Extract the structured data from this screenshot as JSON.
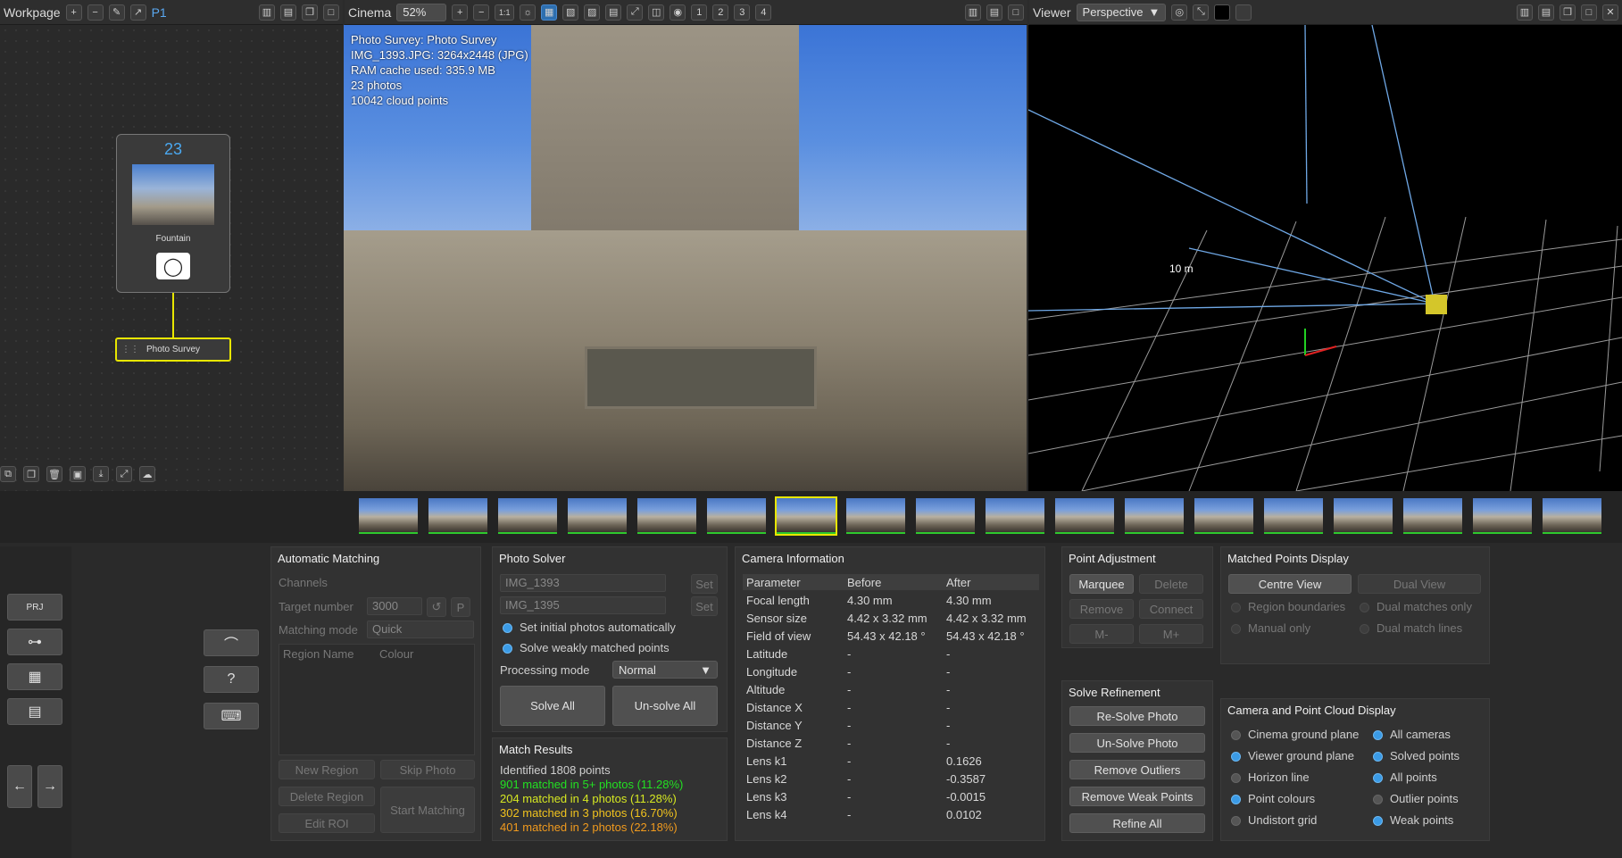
{
  "workpage": {
    "title": "Workpage",
    "page": "P1"
  },
  "cinema": {
    "title": "Cinema",
    "zoom": "52%",
    "ratio": "1:1",
    "nums": [
      "1",
      "2",
      "3",
      "4"
    ],
    "overlay": [
      "Photo Survey: Photo Survey",
      "IMG_1393.JPG: 3264x2448 (JPG)",
      "RAM cache used: 335.9 MB",
      "23 photos",
      "10042 cloud points"
    ]
  },
  "viewer": {
    "title": "Viewer",
    "mode": "Perspective",
    "scale_label": "10 m"
  },
  "nodes": {
    "count": "23",
    "source_label": "Fountain",
    "survey_label": "Photo Survey"
  },
  "auto": {
    "title": "Automatic Matching",
    "channels": "Channels",
    "target_label": "Target number",
    "target_value": "3000",
    "p": "P",
    "mode_label": "Matching mode",
    "mode_value": "Quick",
    "col_region": "Region Name",
    "col_colour": "Colour",
    "new_region": "New Region",
    "skip_photo": "Skip Photo",
    "delete_region": "Delete Region",
    "start_matching": "Start Matching",
    "edit_roi": "Edit ROI"
  },
  "solver": {
    "title": "Photo Solver",
    "img1": "IMG_1393",
    "img2": "IMG_1395",
    "set": "Set",
    "opt1": "Set initial photos automatically",
    "opt2": "Solve weakly matched points",
    "proc_label": "Processing mode",
    "proc_value": "Normal",
    "solve_all": "Solve All",
    "unsolve_all": "Un-solve All"
  },
  "match": {
    "title": "Match Results",
    "identified": "Identified 1808 points",
    "r1": "901 matched in 5+ photos (11.28%)",
    "r2": "204 matched in 4 photos (11.28%)",
    "r3": "302 matched in 3 photos (16.70%)",
    "r4": "401 matched in 2 photos (22.18%)",
    "colors": [
      "#22e022",
      "#d6e822",
      "#f0c21e",
      "#f09a1e"
    ]
  },
  "camera": {
    "title": "Camera Information",
    "headers": [
      "Parameter",
      "Before",
      "After"
    ],
    "rows": [
      [
        "Focal length",
        "4.30 mm",
        "4.30 mm"
      ],
      [
        "Sensor size",
        "4.42 x 3.32 mm",
        "4.42 x 3.32 mm"
      ],
      [
        "Field of view",
        "54.43 x 42.18 °",
        "54.43 x 42.18 °"
      ],
      [
        "Latitude",
        "-",
        "-"
      ],
      [
        "Longitude",
        "-",
        "-"
      ],
      [
        "Altitude",
        "-",
        "-"
      ],
      [
        "Distance X",
        "-",
        "-"
      ],
      [
        "Distance Y",
        "-",
        "-"
      ],
      [
        "Distance Z",
        "-",
        "-"
      ],
      [
        "Lens k1",
        "-",
        "0.1626"
      ],
      [
        "Lens k2",
        "-",
        "-0.3587"
      ],
      [
        "Lens k3",
        "-",
        "-0.0015"
      ],
      [
        "Lens k4",
        "-",
        "0.0102"
      ]
    ]
  },
  "point_adj": {
    "title": "Point Adjustment",
    "marquee": "Marquee",
    "delete": "Delete",
    "remove": "Remove",
    "connect": "Connect",
    "m_minus": "M-",
    "m_plus": "M+"
  },
  "solve_ref": {
    "title": "Solve Refinement",
    "b1": "Re-Solve Photo",
    "b2": "Un-Solve Photo",
    "b3": "Remove Outliers",
    "b4": "Remove Weak Points",
    "b5": "Refine All"
  },
  "mpd": {
    "title": "Matched Points Display",
    "centre": "Centre View",
    "dual": "Dual View",
    "o1": "Region boundaries",
    "o2": "Dual matches only",
    "o3": "Manual only",
    "o4": "Dual match lines"
  },
  "cpcd": {
    "title": "Camera and Point Cloud Display",
    "left": [
      "Cinema ground plane",
      "Viewer ground plane",
      "Horizon line",
      "Point colours",
      "Undistort grid"
    ],
    "right": [
      "All cameras",
      "Solved points",
      "All points",
      "Outlier points",
      "Weak points"
    ]
  },
  "side": {
    "prj": "PRJ"
  }
}
